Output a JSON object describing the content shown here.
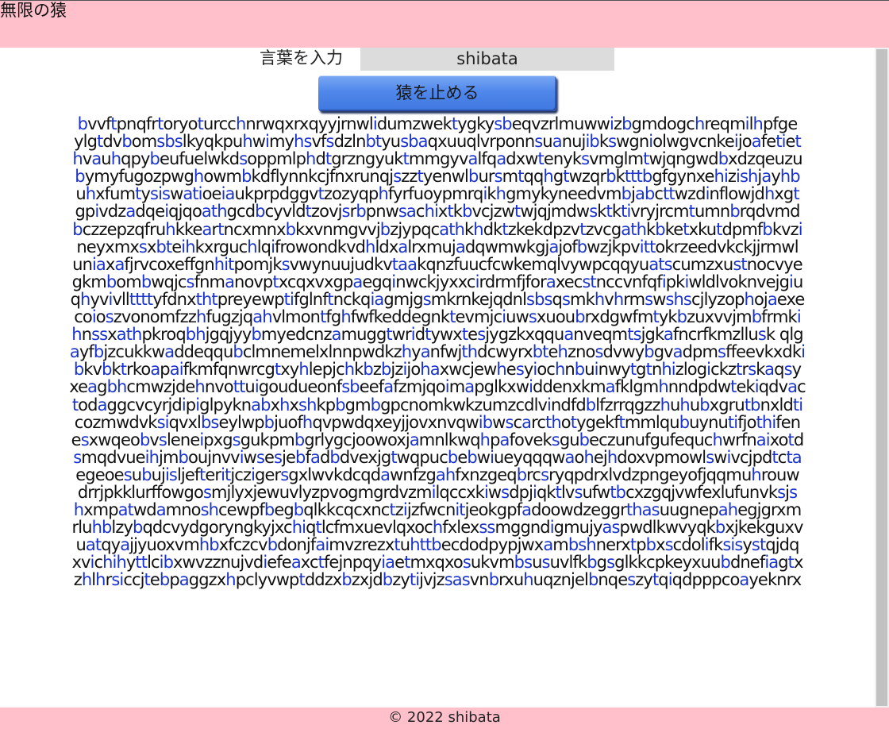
{
  "header": {
    "title": "無限の猿"
  },
  "form": {
    "label": "言葉を入力",
    "input_value": "shibata",
    "stop_button_label": "猿を止める"
  },
  "highlight_letters": "shibat",
  "colors": {
    "header_bg": "#ffc0cb",
    "footer_bg": "#ffc0cb",
    "input_bg": "#dcdcdc",
    "button": "#4f87ea",
    "highlight": "#1a33cc"
  },
  "monkey_text": {
    "lines": [
      "bvvftpnqfrtoryoturcchnrwqxrxqyyjrnwlidumzwektygkysbeqvzrlmuwwizbgmdogchreqmilhpfge",
      "ylgtdvbomsbslkyqkpuhwimyhsvfsdzlnbtyusbaqxuuqlvrponnsuanujibkswgniolwgvcnkeijoafetiet",
      "hvauhqpybeufuelwkdsoppmlphdtgrzngyuktmmgyvalfqadxwtenyksvmglmtwjqngwdbxdzqeuzu",
      "bymyfugozpwghowmbkdflynnkcjfnxrunqjszztyenwlbursmtqqhgtwzqrbktttbgfgynxehizishjayhb",
      "uhxfumtysiswatioeiaukprpdggvtzozyqphfyrfuoypmrqikhgmykyneedvmbjabcttwzdinflowjdhxgt",
      "gpivdzadqeiqjqoathgcdbcyvldtzovjsrbpnwsachixtkbvcjzwtwjqjmdwsktktivryjrcmtumnbrqdvmd",
      "bczzepzqfruhkkeartncxmnxbkxvnmgvvjbzjypqcathkhdktzkekdpzvtzvcgathkbketxkutdpmfbkvzi",
      "neyxmxsxbteihkxrguchlqifrowondkvdhldxalrxmujadqwmwkgjajofbwzjkpvittokrzeedvkckjjrmwl",
      "uniaxafjrvcoxeffgnhitpomjksvwynuujudkvtaakqnzfuucfcwkemqlvywpcqqyuatscumzxustnocvye",
      "gkmbombwqjcsfnmanovptxcqxvxgpaegqinwckjyxxcirdrmfjforaxecstnccvnfqfipkiwldlvoknvejgiu",
      "qhyvivllttttyfdnxthtpreyewptifglnftnckqiagmjgsmkrnkejqdnlsbsqsmkhvhrmswshscjlyzophojaexe",
      "coioszvonomfzzhfugzjqahvlmontfghfwfkeddegnktevmjciuwsxuoubrxdgwfmtykbzuxvvjmbfrmki",
      "hnssxathpkroqbhjgqjyybmyedcnzamuggtwridtywxtesjygzkxqquanveqmtsjgkafncrfkmzllusk qlg",
      "ayfbjzcukkwaddeqqubclmnemelxlnnpwdkzhyanfwjthdcwyrxbtehznosdvwybgvadpmsffeevkxdki",
      "bkvbktrkoapaifkmfqnwrcgtxyhlepjchkbzbjzijohaxwcjewhesyiochnbuinwytgtnhizlogickztrskaqsy",
      "xeagbhcmwzjdehnvottuigoudueonfsbeefafzmjqoimapglkxwiddenxkmafklgmhnndpdwtekiqdvac",
      "todaggcvcyrjdipiglpyknabxhxshkpbgmbgpcnomkwkzumzcdlvindfdblfzrrqgzzhuhubxgrutbnxldti",
      "cozmwdvksiqvxlbseylwpbjuofhqvpwdqxeyjjovxnvqwibwscarcthotygekftmmlqubuynutifjothifen",
      "esxwqeobvslenеipxgsgukpmbgrlygcjoowoxjamnlkwqhpafoveksgubeczunufgufequchwrfnaixotd",
      "smqdvueihjmboujnvviwsesjebfadbdvexjgtwqpucbebwiueyqqqwaohejhdoxvpmowlswivcjpdtcta",
      "egeoesubujisljefteritjczigersgxlwvkdcqdawnfzgahfxnzgeqbrcsryqpdrxlvdzpngeyofjqqmuhrouw",
      "drrjpkklurffowgosmjlyxjewuvlyzpvogmgrdvzmilqccxkiwsdpjiqktlvsufwtbcxzgqjvwfexlufunvksjs",
      "hxmpatwdamnoshcewpfbegbqlkkcqcxnctzijzfwcnitjeokgpfadoowdzeggrthasuugnepahegjgrxm",
      "rluhblzybqdcvydgoryngkyjxchiqtlcfmxuevlqxochfxlexssmggndigmujyaspwdlkwvyqkbxjkekguxv",
      "uatqyajjyuoxvmhbxfczcvbdonjfaimvzrezxtuhttbecdodpypjwxambshnerxtpbxscdolifksisystqjdq",
      "xvichihyttlcibxwvzznujvdiefeaxctfejnpqyiaetmxqxosukvmbsusuvlfkbgsglkkcpkeyxuubdnefiagtx",
      "zhlhrsiccjtebpaggzxhpclyvwptddzxbzxjdbzytijvjzsasvnbrxuhuqznjelbnqeszytqiqdpppcoayeknrx"
    ]
  },
  "footer": {
    "copyright": "© 2022 shibata"
  }
}
